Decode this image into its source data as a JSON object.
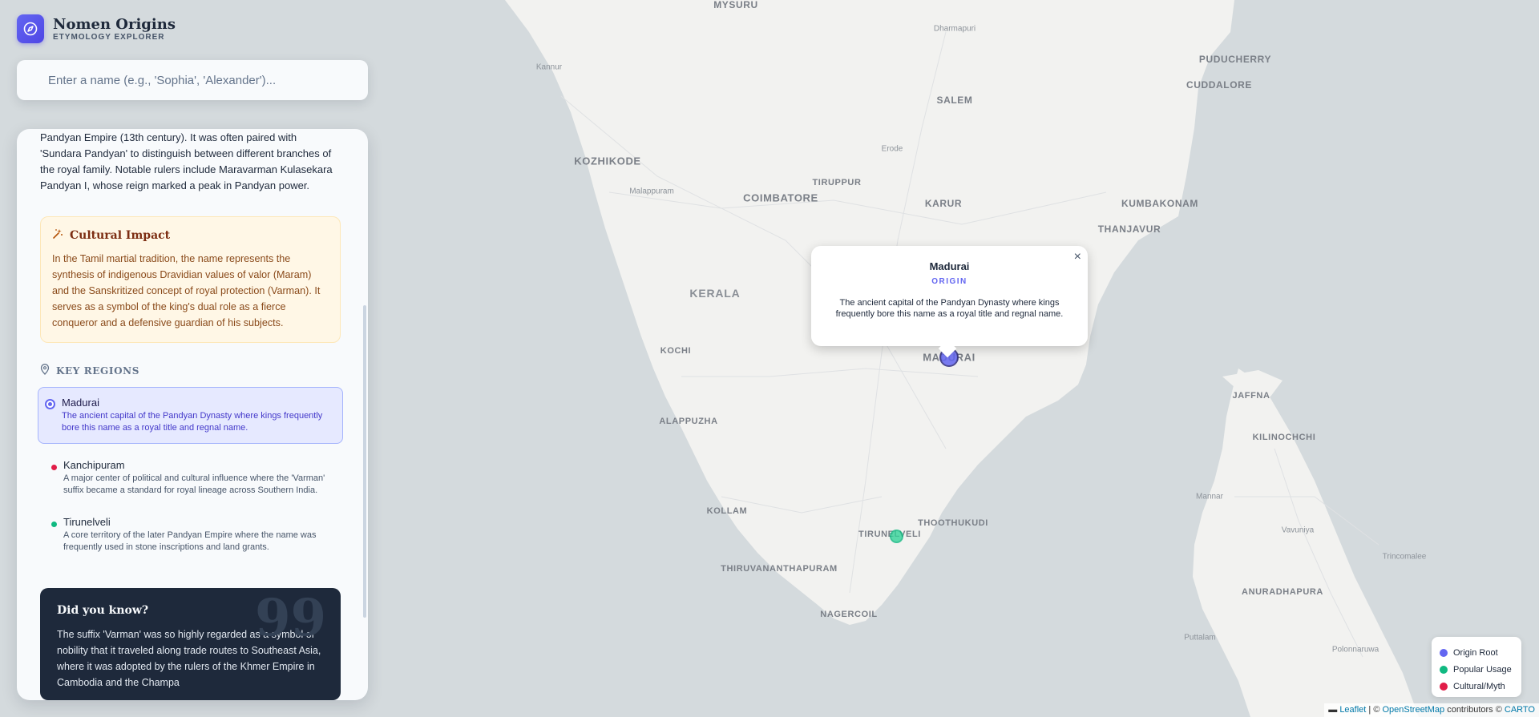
{
  "app": {
    "title": "Nomen Origins",
    "subtitle": "ETYMOLOGY EXPLORER"
  },
  "search": {
    "placeholder": "Enter a name (e.g., 'Sophia', 'Alexander')..."
  },
  "panel": {
    "story": "Pandyan Empire (13th century). It was often paired with 'Sundara Pandyan' to distinguish between different branches of the royal family. Notable rulers include Maravarman Kulasekara Pandyan I, whose reign marked a peak in Pandyan power.",
    "cultural_impact": {
      "title": "Cultural Impact",
      "text": "In the Tamil martial tradition, the name represents the synthesis of indigenous Dravidian values of valor (Maram) and the Sanskritized concept of royal protection (Varman). It serves as a symbol of the king's dual role as a fierce conqueror and a defensive guardian of his subjects."
    },
    "key_regions": {
      "title": "KEY REGIONS",
      "items": [
        {
          "name": "Madurai",
          "desc": "The ancient capital of the Pandyan Dynasty where kings frequently bore this name as a royal title and regnal name.",
          "color": "#6366f1",
          "active": true
        },
        {
          "name": "Kanchipuram",
          "desc": "A major center of political and cultural influence where the 'Varman' suffix became a standard for royal lineage across Southern India.",
          "color": "#e11d48",
          "active": false
        },
        {
          "name": "Tirunelveli",
          "desc": "A core territory of the later Pandyan Empire where the name was frequently used in stone inscriptions and land grants.",
          "color": "#10b981",
          "active": false
        }
      ]
    },
    "did_you_know": {
      "title": "Did you know?",
      "text": "The suffix 'Varman' was so highly regarded as a symbol of nobility that it traveled along trade routes to Southeast Asia, where it was adopted by the rulers of the Khmer Empire in Cambodia and the Champa"
    }
  },
  "popup": {
    "title": "Madurai",
    "tag": "ORIGIN",
    "text": "The ancient capital of the Pandyan Dynasty where kings frequently bore this name as a royal title and regnal name.",
    "close": "×"
  },
  "map_labels": {
    "mysuru": "MYSURU",
    "dharmapuri": "Dharmapuri",
    "puducherry": "PUDUCHERRY",
    "cuddalore": "CUDDALORE",
    "kannur": "Kannur",
    "salem": "SALEM",
    "kozhikode": "KOZHIKODE",
    "erode": "Erode",
    "malappuram": "Malappuram",
    "tiruppur": "TIRUPPUR",
    "coimbatore": "COIMBATORE",
    "karur": "KARUR",
    "kumbakonam": "KUMBAKONAM",
    "thanjavur": "THANJAVUR",
    "kerala": "KERALA",
    "kochi": "KOCHI",
    "madurai": "MADURAI",
    "jaffna": "JAFFNA",
    "alappuzha": "ALAPPUZHA",
    "kilinochchi": "KILINOCHCHI",
    "mannar": "Mannar",
    "kollam": "KOLLAM",
    "thoothukudi": "THOOTHUKUDI",
    "tirunelveli": "TIRUNELVELI",
    "vavuniya": "Vavuniya",
    "trincomalee": "Trincomalee",
    "thiruvananthapuram": "THIRUVANANTHAPURAM",
    "anuradhapura": "ANURADHAPURA",
    "nagercoil": "NAGERCOIL",
    "puttalam": "Puttalam",
    "polonnaruwa": "Polonnaruwa"
  },
  "legend": [
    {
      "label": "Origin Root",
      "color": "#6366f1"
    },
    {
      "label": "Popular Usage",
      "color": "#10b981"
    },
    {
      "label": "Cultural/Myth",
      "color": "#e11d48"
    }
  ],
  "attribution": {
    "leaflet": "Leaflet",
    "sep1": " | © ",
    "osm": "OpenStreetMap",
    "sep2": " contributors © ",
    "carto": "CARTO"
  }
}
